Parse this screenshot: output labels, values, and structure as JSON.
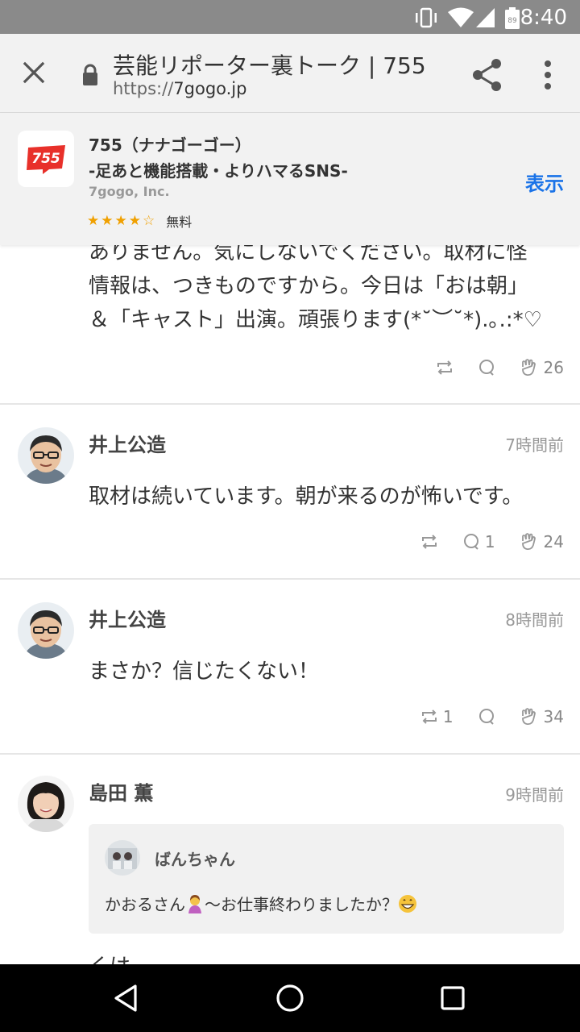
{
  "status_bar": {
    "time": "8:40",
    "battery_level": "89",
    "icons": [
      "vibrate-icon",
      "wifi-icon",
      "signal-icon",
      "battery-icon"
    ]
  },
  "toolbar": {
    "title": "芸能リポーター裏トーク | 755",
    "url_scheme": "https://",
    "url_host": "7gogo.jp",
    "icons": [
      "close-icon",
      "lock-icon",
      "share-icon",
      "more-vert-icon"
    ]
  },
  "app_banner": {
    "logo_text": "755",
    "name": "755（ナナゴーゴー）",
    "tagline": "-足あと機能搭載・よりハマるSNS-",
    "developer": "7gogo, Inc.",
    "rating": 4,
    "rating_max": 5,
    "price": "無料",
    "view_label": "表示"
  },
  "posts": [
    {
      "text_lines": [
        "ありません。気にしないでください。取材に怪",
        "情報は、つきものですから。今日は「おは朝」",
        "＆「キャスト」出演。頑張ります(*˘︶˘*).｡.:*♡"
      ],
      "repost_count": "",
      "comment_count": "",
      "like_count": "26"
    },
    {
      "author": "井上公造",
      "time": "7時間前",
      "text": "取材は続いています。朝が来るのが怖いです。",
      "repost_count": "",
      "comment_count": "1",
      "like_count": "24"
    },
    {
      "author": "井上公造",
      "time": "8時間前",
      "text": "まさか？信じたくない！",
      "repost_count": "1",
      "comment_count": "",
      "like_count": "34"
    },
    {
      "author": "島田 薫",
      "time": "9時間前",
      "quote_author": "ばんちゃん",
      "quote_text_before": "かおるさん",
      "quote_text_middle": "〜お仕事終わりましたか？",
      "cut_text": "くは…"
    }
  ],
  "colors": {
    "accent": "#1a73e8",
    "status_bar": "#8a8a8a",
    "logo_red": "#e8302a",
    "star": "#f0a000"
  }
}
